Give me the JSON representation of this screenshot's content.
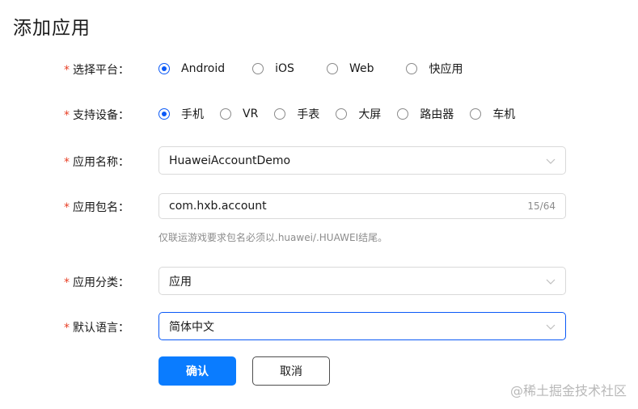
{
  "page": {
    "title": "添加应用"
  },
  "platform": {
    "label": "选择平台：",
    "required_mark": "*",
    "options": [
      "Android",
      "iOS",
      "Web",
      "快应用"
    ],
    "selected": "Android"
  },
  "device": {
    "label": "支持设备：",
    "required_mark": "*",
    "options": [
      "手机",
      "VR",
      "手表",
      "大屏",
      "路由器",
      "车机"
    ],
    "selected": "手机"
  },
  "app_name": {
    "label": "应用名称：",
    "required_mark": "*",
    "value": "HuaweiAccountDemo",
    "icon": "chevron-down-icon"
  },
  "package_name": {
    "label": "应用包名：",
    "required_mark": "*",
    "value": "com.hxb.account",
    "counter": "15/64",
    "hint": "仅联运游戏要求包名必须以.huawei/.HUAWEI结尾。"
  },
  "category": {
    "label": "应用分类：",
    "required_mark": "*",
    "value": "应用",
    "icon": "chevron-down-icon"
  },
  "language": {
    "label": "默认语言：",
    "required_mark": "*",
    "value": "简体中文",
    "icon": "chevron-down-icon"
  },
  "buttons": {
    "confirm": "确认",
    "cancel": "取消"
  },
  "watermark": "@稀土掘金技术社区",
  "colors": {
    "accent": "#0a59f7",
    "primary_button": "#0a7cff",
    "required": "#e84026"
  }
}
